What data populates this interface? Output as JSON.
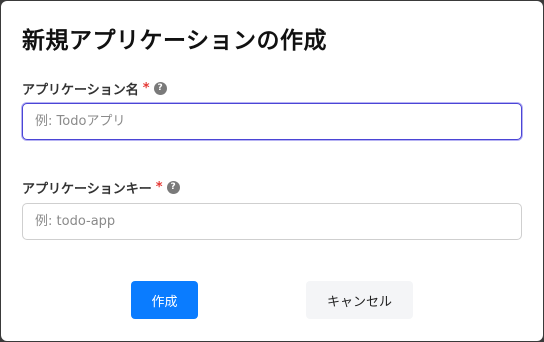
{
  "dialog": {
    "title": "新規アプリケーションの作成",
    "fields": [
      {
        "label": "アプリケーション名",
        "required_mark": "*",
        "help_icon": "?",
        "placeholder": "例: Todoアプリ",
        "value": "",
        "focused": true
      },
      {
        "label": "アプリケーションキー",
        "required_mark": "*",
        "help_icon": "?",
        "placeholder": "例: todo-app",
        "value": "",
        "focused": false
      }
    ],
    "buttons": {
      "create_label": "作成",
      "cancel_label": "キャンセル"
    }
  },
  "colors": {
    "primary": "#0a7cff",
    "focus_border": "#4b45d6",
    "required": "#e53935"
  }
}
